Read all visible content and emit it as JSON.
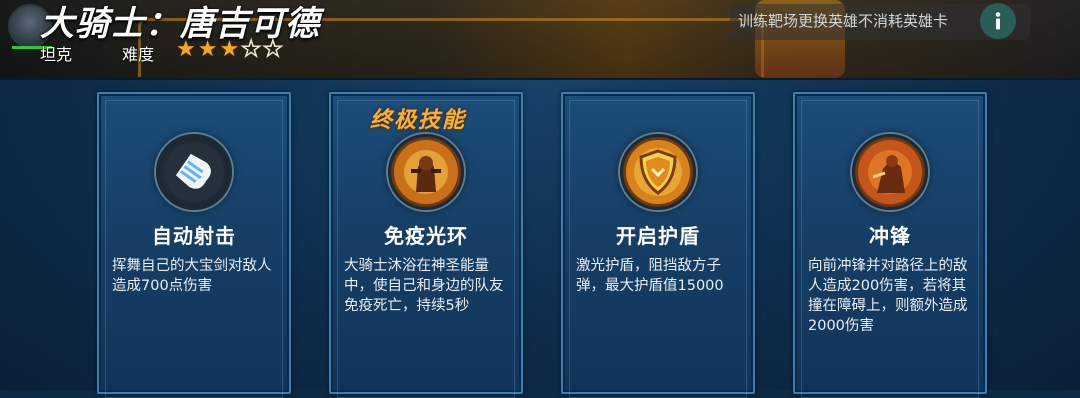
{
  "hero": {
    "title": "大骑士：唐吉可德",
    "class_label": "坦克",
    "difficulty_label": "难度",
    "difficulty_rating": 3,
    "difficulty_max": 5
  },
  "notice": {
    "text": "训练靶场更换英雄不消耗英雄卡"
  },
  "icons": {
    "info": "info-icon",
    "star_filled": "star-filled-icon",
    "star_empty": "star-outline-icon"
  },
  "colors": {
    "star": "#f5a820",
    "card_bg": "#174266",
    "card_border": "#3d7fb2",
    "ultimate_label": "#f3b23a",
    "hp_bar": "#35c23a"
  },
  "skills": [
    {
      "name": "自动射击",
      "description": "挥舞自己的大宝剑对敌人造成700点伤害",
      "icon": "bullet-icon",
      "ultimate_label": ""
    },
    {
      "name": "免疫光环",
      "description": "大骑士沐浴在神圣能量中，使自己和身边的队友免疫死亡，持续5秒",
      "icon": "holy-knight-icon",
      "ultimate_label": "终极技能"
    },
    {
      "name": "开启护盾",
      "description": "激光护盾，阻挡敌方子弹，最大护盾值15000",
      "icon": "shield-icon",
      "ultimate_label": ""
    },
    {
      "name": "冲锋",
      "description": "向前冲锋并对路径上的敌人造成200伤害，若将其撞在障碍上，则额外造成2000伤害",
      "icon": "charge-icon",
      "ultimate_label": ""
    }
  ]
}
